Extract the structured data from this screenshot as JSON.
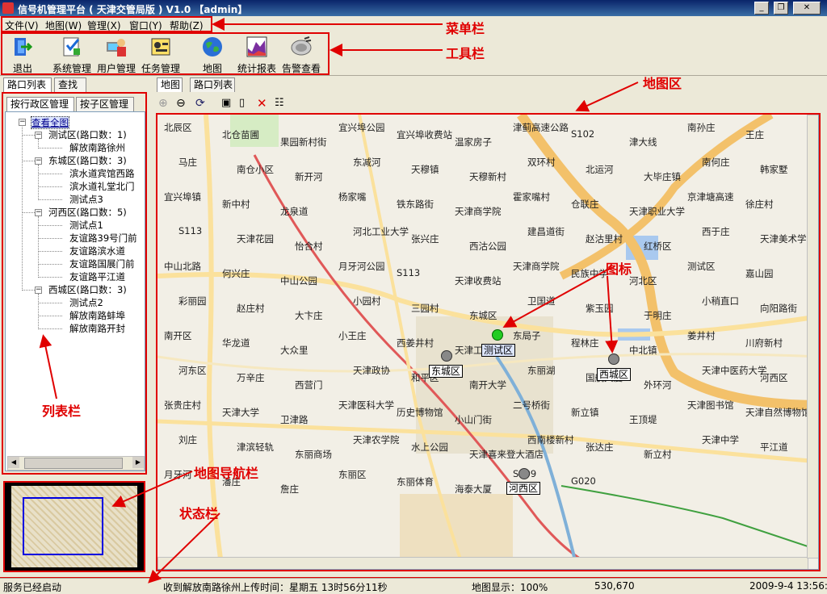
{
  "window": {
    "title": "信号机管理平台 ( 天津交管局版 ) V1.0  【admin】",
    "buttons": [
      "_",
      "❐",
      "✕"
    ]
  },
  "menu": [
    "文件(V)",
    "地图(W)",
    "管理(X)",
    "窗口(Y)",
    "帮助(Z)"
  ],
  "toolbar": [
    {
      "label": "退出",
      "icon": "exit-icon"
    },
    {
      "label": "系统管理",
      "icon": "system-settings-icon"
    },
    {
      "label": "用户管理",
      "icon": "user-management-icon"
    },
    {
      "label": "任务管理",
      "icon": "task-management-icon"
    },
    {
      "label": "地图",
      "icon": "globe-icon"
    },
    {
      "label": "统计报表",
      "icon": "chart-report-icon"
    },
    {
      "label": "告警查看",
      "icon": "alarm-view-icon"
    }
  ],
  "left_tabs": [
    "路口列表",
    "查找"
  ],
  "sub_tabs": [
    "按行政区管理",
    "按子区管理"
  ],
  "tree": {
    "root": "查看全图",
    "groups": [
      {
        "label": "测试区(路口数：1)",
        "items": [
          "解放南路徐州"
        ]
      },
      {
        "label": "东城区(路口数：3)",
        "items": [
          "滨水道宾馆西路",
          "滨水道礼堂北门",
          "测试点3"
        ]
      },
      {
        "label": "河西区(路口数：5)",
        "items": [
          "测试点1",
          "友谊路39号门前",
          "友谊路滨水道",
          "友谊路国展门前",
          "友谊路平江道"
        ]
      },
      {
        "label": "西城区(路口数：3)",
        "items": [
          "测试点2",
          "解放南路蚌埠",
          "解放南路开封"
        ]
      }
    ]
  },
  "map_tabs": [
    "地图",
    "路口列表"
  ],
  "map_tools": [
    "zoom-in-icon",
    "zoom-out-icon",
    "refresh-icon",
    "save-icon",
    "new-icon",
    "delete-icon",
    "properties-icon"
  ],
  "map_labels": [
    "北辰区",
    "北仓苗圃",
    "果园新村街",
    "宜兴埠公园",
    "宜兴埠收费站",
    "温家房子",
    "津蓟高速公路",
    "S102",
    "津大线",
    "南孙庄",
    "王庄",
    "马庄",
    "南仓小区",
    "新开河",
    "东减河",
    "天穆镇",
    "天穆新村",
    "双环村",
    "北运河",
    "大毕庄镇",
    "南何庄",
    "韩家墅",
    "宜兴埠镇",
    "新中村",
    "龙泉道",
    "杨家嘴",
    "铁东路街",
    "天津商学院",
    "霍家嘴村",
    "仓联庄",
    "天津职业大学",
    "京津塘高速",
    "徐庄村",
    "S113",
    "天津花园",
    "怡合村",
    "河北工业大学",
    "张兴庄",
    "西沽公园",
    "建昌道街",
    "赵沽里村",
    "红桥区",
    "西于庄",
    "天津美术学院",
    "中山北路",
    "何兴庄",
    "中山公园",
    "月牙河公园",
    "S113",
    "天津收费站",
    "天津商学院",
    "民族中学",
    "河北区",
    "测试区",
    "嘉山园",
    "彩丽园",
    "赵庄村",
    "大卞庄",
    "小园村",
    "三园村",
    "东城区",
    "卫国道",
    "紫玉园",
    "于明庄",
    "小稍直口",
    "向阳路街",
    "南开区",
    "华龙道",
    "大众里",
    "小王庄",
    "西姜井村",
    "天津工业大学",
    "东局子",
    "程林庄",
    "中北镇",
    "姜井村",
    "川府新村",
    "河东区",
    "万辛庄",
    "西营门",
    "天津政协",
    "和平区",
    "南开大学",
    "东丽湖",
    "国航大厦",
    "外环河",
    "天津中医药大学",
    "河西区",
    "张贵庄村",
    "天津大学",
    "卫津路",
    "天津医科大学",
    "历史博物馆",
    "小山门街",
    "二号桥街",
    "新立镇",
    "王顶堤",
    "天津图书馆",
    "天津自然博物馆",
    "刘庄",
    "津滨轻轨",
    "东丽商场",
    "天津农学院",
    "水上公园",
    "天津喜来登大酒店",
    "西南楼新村",
    "张达庄",
    "新立村",
    "天津中学",
    "平江道",
    "月牙河",
    "潘庄",
    "詹庄",
    "东丽区",
    "东丽体育",
    "海泰大厦",
    "S209",
    "G020"
  ],
  "map_markers": [
    {
      "label": "测试区",
      "color": "#22cc22",
      "selected": true
    },
    {
      "label": "东城区",
      "color": "#888888",
      "selected": false
    },
    {
      "label": "西城区",
      "color": "#888888",
      "selected": false
    },
    {
      "label": "河西区",
      "color": "#888888",
      "selected": false
    }
  ],
  "annotations": {
    "menubar": "菜单栏",
    "toolbar": "工具栏",
    "maparea": "地图区",
    "icon": "图标",
    "list": "列表栏",
    "nav": "地图导航栏",
    "status": "状态栏"
  },
  "status": {
    "service": "服务已经启动",
    "message": "收到解放南路徐州上传时间：星期五 13时56分11秒",
    "zoom": "地图显示：100%",
    "coords": "530,670",
    "datetime": "2009-9-4 13:56:44"
  },
  "colors": {
    "annotation": "#e00000",
    "title_bar": "#0a246a"
  }
}
